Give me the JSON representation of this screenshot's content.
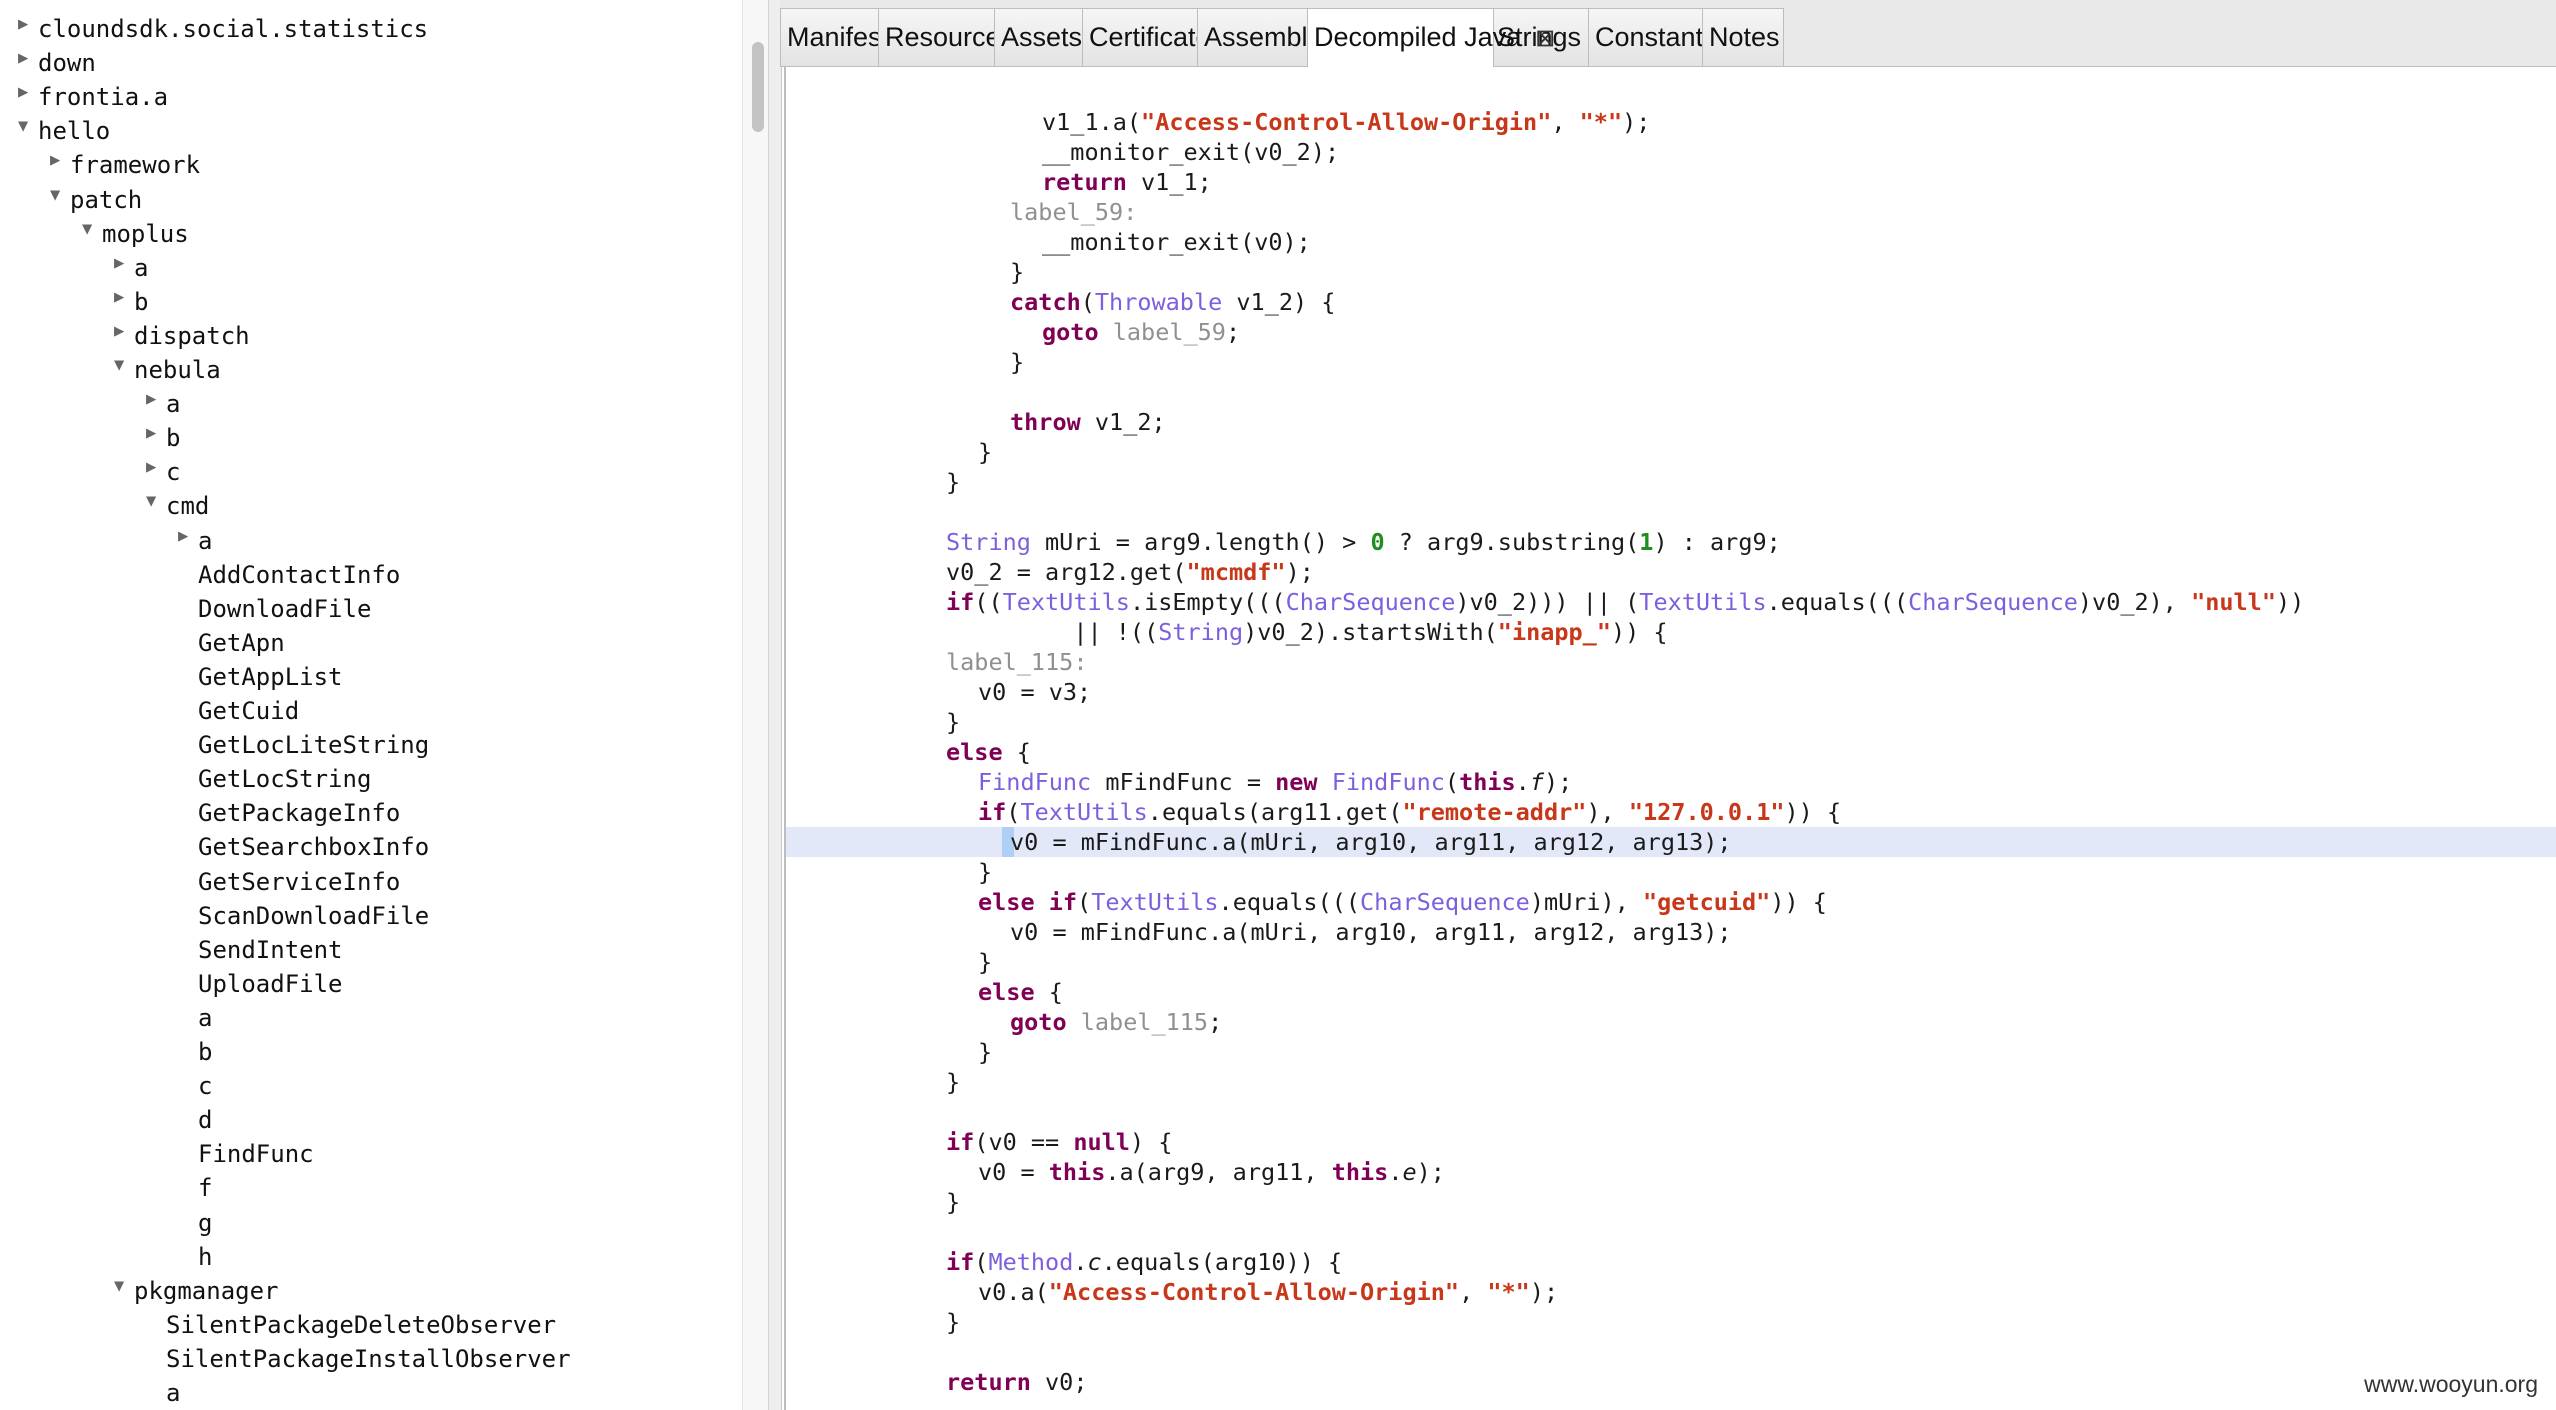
{
  "tree": [
    {
      "label": "cloundsdk.social.statistics",
      "depth": 0,
      "toggle": "collapsed"
    },
    {
      "label": "down",
      "depth": 0,
      "toggle": "collapsed"
    },
    {
      "label": "frontia.a",
      "depth": 0,
      "toggle": "collapsed"
    },
    {
      "label": "hello",
      "depth": 0,
      "toggle": "expanded"
    },
    {
      "label": "framework",
      "depth": 1,
      "toggle": "collapsed"
    },
    {
      "label": "patch",
      "depth": 1,
      "toggle": "expanded"
    },
    {
      "label": "moplus",
      "depth": 2,
      "toggle": "expanded"
    },
    {
      "label": "a",
      "depth": 3,
      "toggle": "collapsed"
    },
    {
      "label": "b",
      "depth": 3,
      "toggle": "collapsed"
    },
    {
      "label": "dispatch",
      "depth": 3,
      "toggle": "collapsed"
    },
    {
      "label": "nebula",
      "depth": 3,
      "toggle": "expanded"
    },
    {
      "label": "a",
      "depth": 4,
      "toggle": "collapsed"
    },
    {
      "label": "b",
      "depth": 4,
      "toggle": "collapsed"
    },
    {
      "label": "c",
      "depth": 4,
      "toggle": "collapsed"
    },
    {
      "label": "cmd",
      "depth": 4,
      "toggle": "expanded"
    },
    {
      "label": "a",
      "depth": 5,
      "toggle": "collapsed"
    },
    {
      "label": "AddContactInfo",
      "depth": 5,
      "toggle": "none"
    },
    {
      "label": "DownloadFile",
      "depth": 5,
      "toggle": "none"
    },
    {
      "label": "GetApn",
      "depth": 5,
      "toggle": "none"
    },
    {
      "label": "GetAppList",
      "depth": 5,
      "toggle": "none"
    },
    {
      "label": "GetCuid",
      "depth": 5,
      "toggle": "none"
    },
    {
      "label": "GetLocLiteString",
      "depth": 5,
      "toggle": "none"
    },
    {
      "label": "GetLocString",
      "depth": 5,
      "toggle": "none"
    },
    {
      "label": "GetPackageInfo",
      "depth": 5,
      "toggle": "none"
    },
    {
      "label": "GetSearchboxInfo",
      "depth": 5,
      "toggle": "none"
    },
    {
      "label": "GetServiceInfo",
      "depth": 5,
      "toggle": "none"
    },
    {
      "label": "ScanDownloadFile",
      "depth": 5,
      "toggle": "none"
    },
    {
      "label": "SendIntent",
      "depth": 5,
      "toggle": "none"
    },
    {
      "label": "UploadFile",
      "depth": 5,
      "toggle": "none"
    },
    {
      "label": "a",
      "depth": 5,
      "toggle": "none"
    },
    {
      "label": "b",
      "depth": 5,
      "toggle": "none"
    },
    {
      "label": "c",
      "depth": 5,
      "toggle": "none"
    },
    {
      "label": "d",
      "depth": 5,
      "toggle": "none"
    },
    {
      "label": "FindFunc",
      "depth": 5,
      "toggle": "none"
    },
    {
      "label": "f",
      "depth": 5,
      "toggle": "none"
    },
    {
      "label": "g",
      "depth": 5,
      "toggle": "none"
    },
    {
      "label": "h",
      "depth": 5,
      "toggle": "none"
    },
    {
      "label": "pkgmanager",
      "depth": 3,
      "toggle": "expanded"
    },
    {
      "label": "SilentPackageDeleteObserver",
      "depth": 4,
      "toggle": "none"
    },
    {
      "label": "SilentPackageInstallObserver",
      "depth": 4,
      "toggle": "none"
    },
    {
      "label": "a",
      "depth": 4,
      "toggle": "none"
    }
  ],
  "tabs": [
    {
      "label": "Manifest",
      "active": false
    },
    {
      "label": "Resources",
      "active": false
    },
    {
      "label": "Assets",
      "active": false
    },
    {
      "label": "Certificate",
      "active": false
    },
    {
      "label": "Assembly",
      "active": false
    },
    {
      "label": "Decompiled Java",
      "active": true,
      "close_glyph": "⊠"
    },
    {
      "label": "Strings",
      "active": false
    },
    {
      "label": "Constants",
      "active": false
    },
    {
      "label": "Notes",
      "active": false
    }
  ],
  "code": {
    "highlight_line_index": 24,
    "lines": [
      {
        "indent": 8,
        "tokens": [
          [
            "",
            "v1_1.a("
          ],
          [
            "s",
            "\"Access-Control-Allow-Origin\""
          ],
          [
            "",
            ", "
          ],
          [
            "s",
            "\"*\""
          ],
          [
            "",
            ");"
          ]
        ]
      },
      {
        "indent": 8,
        "tokens": [
          [
            "",
            "__monitor_exit(v0_2);"
          ]
        ]
      },
      {
        "indent": 8,
        "tokens": [
          [
            "k",
            "return"
          ],
          [
            "",
            " v1_1;"
          ]
        ]
      },
      {
        "indent": 6,
        "tokens": [
          [
            "l",
            "label_59:"
          ]
        ]
      },
      {
        "indent": 8,
        "tokens": [
          [
            "",
            "__monitor_exit(v0);"
          ]
        ]
      },
      {
        "indent": 6,
        "tokens": [
          [
            "",
            "}"
          ]
        ]
      },
      {
        "indent": 6,
        "tokens": [
          [
            "k",
            "catch"
          ],
          [
            "",
            "("
          ],
          [
            "t",
            "Throwable"
          ],
          [
            "",
            " v1_2) {"
          ]
        ]
      },
      {
        "indent": 8,
        "tokens": [
          [
            "k",
            "goto"
          ],
          [
            "",
            " "
          ],
          [
            "l",
            "label_59"
          ],
          [
            "",
            ";"
          ]
        ]
      },
      {
        "indent": 6,
        "tokens": [
          [
            "",
            "}"
          ]
        ]
      },
      {
        "indent": 0,
        "tokens": []
      },
      {
        "indent": 6,
        "tokens": [
          [
            "k",
            "throw"
          ],
          [
            "",
            " v1_2;"
          ]
        ]
      },
      {
        "indent": 4,
        "tokens": [
          [
            "",
            "}"
          ]
        ]
      },
      {
        "indent": 2,
        "tokens": [
          [
            "",
            "}"
          ]
        ]
      },
      {
        "indent": 0,
        "tokens": []
      },
      {
        "indent": 2,
        "tokens": [
          [
            "t",
            "String"
          ],
          [
            "",
            " mUri = arg9.length() > "
          ],
          [
            "n",
            "0"
          ],
          [
            "",
            " ? arg9.substring("
          ],
          [
            "n",
            "1"
          ],
          [
            "",
            ") : arg9;"
          ]
        ]
      },
      {
        "indent": 2,
        "tokens": [
          [
            "",
            "v0_2 = arg12.get("
          ],
          [
            "s",
            "\"mcmdf\""
          ],
          [
            "",
            ");"
          ]
        ]
      },
      {
        "indent": 2,
        "tokens": [
          [
            "k",
            "if"
          ],
          [
            "",
            "(("
          ],
          [
            "t",
            "TextUtils"
          ],
          [
            "",
            ".isEmpty((("
          ],
          [
            "t",
            "CharSequence"
          ],
          [
            "",
            ")v0_2))) || ("
          ],
          [
            "t",
            "TextUtils"
          ],
          [
            "",
            ".equals((("
          ],
          [
            "t",
            "CharSequence"
          ],
          [
            "",
            ")v0_2), "
          ],
          [
            "s",
            "\"null\""
          ],
          [
            "",
            "))"
          ]
        ]
      },
      {
        "indent": 2,
        "tokens": [
          [
            "",
            "         || !(("
          ],
          [
            "t",
            "String"
          ],
          [
            "",
            ")v0_2).startsWith("
          ],
          [
            "s",
            "\"inapp_\""
          ],
          [
            "",
            ")) {"
          ]
        ]
      },
      {
        "indent": 2,
        "tokens": [
          [
            "l",
            "label_115:"
          ]
        ]
      },
      {
        "indent": 4,
        "tokens": [
          [
            "",
            "v0 = v3;"
          ]
        ]
      },
      {
        "indent": 2,
        "tokens": [
          [
            "",
            "}"
          ]
        ]
      },
      {
        "indent": 2,
        "tokens": [
          [
            "k",
            "else"
          ],
          [
            "",
            " {"
          ]
        ]
      },
      {
        "indent": 4,
        "tokens": [
          [
            "t",
            "FindFunc"
          ],
          [
            "",
            " mFindFunc = "
          ],
          [
            "k",
            "new"
          ],
          [
            "",
            " "
          ],
          [
            "t",
            "FindFunc"
          ],
          [
            "",
            "("
          ],
          [
            "k",
            "this"
          ],
          [
            "",
            "."
          ],
          [
            "f",
            "f"
          ],
          [
            "",
            ");"
          ]
        ]
      },
      {
        "indent": 4,
        "tokens": [
          [
            "k",
            "if"
          ],
          [
            "",
            "("
          ],
          [
            "t",
            "TextUtils"
          ],
          [
            "",
            ".equals(arg11.get("
          ],
          [
            "s",
            "\"remote-addr\""
          ],
          [
            "",
            "), "
          ],
          [
            "s",
            "\"127.0.0.1\""
          ],
          [
            "",
            "))"
          ],
          [
            "",
            " {"
          ]
        ]
      },
      {
        "indent": 6,
        "tokens": [
          [
            "",
            "v0 = mFindFunc.a(mUri, arg10, arg11, arg12, arg13);"
          ]
        ]
      },
      {
        "indent": 4,
        "tokens": [
          [
            "",
            "}"
          ]
        ]
      },
      {
        "indent": 4,
        "tokens": [
          [
            "k",
            "else if"
          ],
          [
            "",
            "("
          ],
          [
            "t",
            "TextUtils"
          ],
          [
            "",
            ".equals((("
          ],
          [
            "t",
            "CharSequence"
          ],
          [
            "",
            ")mUri), "
          ],
          [
            "s",
            "\"getcuid\""
          ],
          [
            "",
            ")) {"
          ]
        ]
      },
      {
        "indent": 6,
        "tokens": [
          [
            "",
            "v0 = mFindFunc.a(mUri, arg10, arg11, arg12, arg13);"
          ]
        ]
      },
      {
        "indent": 4,
        "tokens": [
          [
            "",
            "}"
          ]
        ]
      },
      {
        "indent": 4,
        "tokens": [
          [
            "k",
            "else"
          ],
          [
            "",
            " {"
          ]
        ]
      },
      {
        "indent": 6,
        "tokens": [
          [
            "k",
            "goto"
          ],
          [
            "",
            " "
          ],
          [
            "l",
            "label_115"
          ],
          [
            "",
            ";"
          ]
        ]
      },
      {
        "indent": 4,
        "tokens": [
          [
            "",
            "}"
          ]
        ]
      },
      {
        "indent": 2,
        "tokens": [
          [
            "",
            "}"
          ]
        ]
      },
      {
        "indent": 0,
        "tokens": []
      },
      {
        "indent": 2,
        "tokens": [
          [
            "k",
            "if"
          ],
          [
            "",
            "(v0 == "
          ],
          [
            "k",
            "null"
          ],
          [
            "",
            ") {"
          ]
        ]
      },
      {
        "indent": 4,
        "tokens": [
          [
            "",
            "v0 = "
          ],
          [
            "k",
            "this"
          ],
          [
            "",
            ".a(arg9, arg11, "
          ],
          [
            "k",
            "this"
          ],
          [
            "",
            "."
          ],
          [
            "f",
            "e"
          ],
          [
            "",
            ");"
          ]
        ]
      },
      {
        "indent": 2,
        "tokens": [
          [
            "",
            "}"
          ]
        ]
      },
      {
        "indent": 0,
        "tokens": []
      },
      {
        "indent": 2,
        "tokens": [
          [
            "k",
            "if"
          ],
          [
            "",
            "("
          ],
          [
            "t",
            "Method"
          ],
          [
            "",
            "."
          ],
          [
            "f",
            "c"
          ],
          [
            "",
            ".equals(arg10)) {"
          ]
        ]
      },
      {
        "indent": 4,
        "tokens": [
          [
            "",
            "v0.a("
          ],
          [
            "s",
            "\"Access-Control-Allow-Origin\""
          ],
          [
            "",
            ", "
          ],
          [
            "s",
            "\"*\""
          ],
          [
            "",
            ");"
          ]
        ]
      },
      {
        "indent": 2,
        "tokens": [
          [
            "",
            "}"
          ]
        ]
      },
      {
        "indent": 0,
        "tokens": []
      },
      {
        "indent": 2,
        "tokens": [
          [
            "k",
            "return"
          ],
          [
            "",
            " v0;"
          ]
        ]
      }
    ]
  },
  "watermark": "www.wooyun.org",
  "colors": {
    "keyword": "#7f0055",
    "type": "#7d5fde",
    "string": "#c8371a",
    "number": "#1f8f1f",
    "label": "#909090",
    "line_highlight": "#e3e8f9",
    "selection": "#afcff5"
  }
}
